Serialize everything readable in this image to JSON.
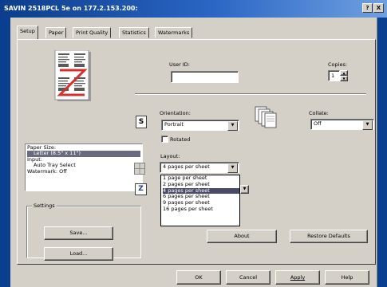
{
  "window": {
    "title": "SAVIN 2518PCL 5e on 177.2.153.200:",
    "help_glyph": "?",
    "close_glyph": "X"
  },
  "tabs": [
    "Setup",
    "Paper",
    "Print Quality",
    "Statistics",
    "Watermarks"
  ],
  "setup": {
    "user_id_label": "User ID:",
    "user_id_value": "",
    "copies_label": "Copies:",
    "copies_value": "1",
    "orientation_label": "Orientation:",
    "orientation_value": "Portrait",
    "orientation_icon_letter": "S",
    "rotated_label": "Rotated",
    "rotated_checked": false,
    "collate_label": "Collate:",
    "collate_value": "Off",
    "layout_label": "Layout:",
    "layout_value": "4 pages per sheet",
    "layout_options": [
      "1 page per sheet",
      "2 pages per sheet",
      "4 pages per sheet",
      "6 pages per sheet",
      "9 pages per sheet",
      "16 pages per sheet"
    ],
    "layout_selected_index": 2,
    "binding_icon_letter": "Z",
    "info": {
      "paper_size_label": "Paper Size:",
      "paper_size_value": "Letter (8.5\" x 11\")",
      "input_label": "Input:",
      "input_value": "Auto Tray Select",
      "watermark_text": "Watermark: Off"
    },
    "settings_group_label": "Settings",
    "save_button": "Save...",
    "load_button": "Load...",
    "about_button": "About",
    "restore_defaults_button": "Restore Defaults"
  },
  "footer": {
    "ok_button": "OK",
    "cancel_button": "Cancel",
    "apply_button": "Apply",
    "help_button": "Help"
  },
  "colors": {
    "title_gradient_start": "#0c3d8c",
    "title_gradient_end": "#6fa0e0",
    "dialog_face": "#d4d0c8",
    "background": "#0a3f8f",
    "selection": "#4a4a66"
  }
}
